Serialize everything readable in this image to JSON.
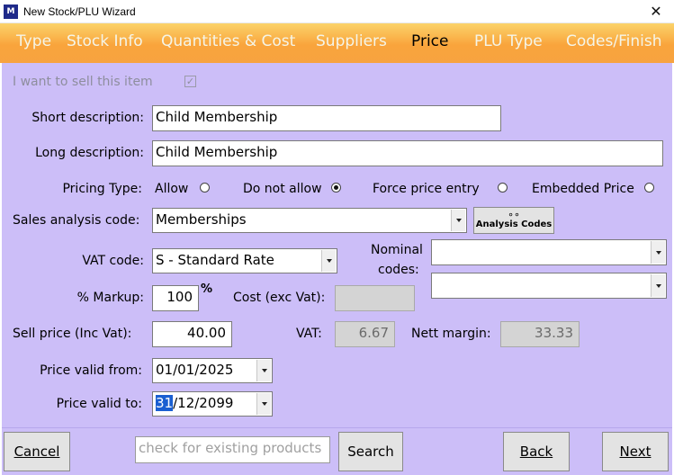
{
  "window": {
    "title": "New Stock/PLU Wizard",
    "icon_text": "M",
    "close_glyph": "✕"
  },
  "tabs": [
    "Type",
    "Stock Info",
    "Quantities & Cost",
    "Suppliers",
    "Price",
    "PLU Type",
    "Codes/Finish"
  ],
  "active_tab": "Price",
  "form": {
    "sell_item_label": "I want to sell this item",
    "sell_item_checked": true,
    "short_desc_label": "Short description:",
    "short_desc_value": "Child Membership",
    "long_desc_label": "Long description:",
    "long_desc_value": "Child Membership",
    "pricing_type_label": "Pricing Type:",
    "pricing_options": [
      "Allow",
      "Do not allow",
      "Force price entry",
      "Embedded Price"
    ],
    "pricing_selected": "Do not allow",
    "sales_code_label": "Sales analysis code:",
    "sales_code_value": "Memberships",
    "analysis_button": "Analysis Codes",
    "vat_code_label": "VAT code:",
    "vat_code_value": "S - Standard Rate",
    "nominal_label_1": "Nominal",
    "nominal_label_2": "codes:",
    "nominal_1": "",
    "nominal_2": "",
    "markup_label": "% Markup:",
    "markup_value": "100",
    "pct_symbol": "%",
    "cost_label": "Cost (exc Vat):",
    "cost_value": "",
    "sell_price_label": "Sell price (Inc Vat):",
    "sell_price_value": "40.00",
    "vat_label": "VAT:",
    "vat_value": "6.67",
    "nett_margin_label": "Nett margin:",
    "nett_margin_value": "33.33",
    "valid_from_label": "Price valid from:",
    "valid_from_value": "01/01/2025",
    "valid_to_label": "Price valid to:",
    "valid_to_day": "31",
    "valid_to_rest": "/12/2099"
  },
  "bottom": {
    "cancel": "Cancel",
    "search_placeholder": "check for existing products",
    "search": "Search",
    "back": "Back",
    "next": "Next"
  },
  "colors": {
    "panel": "#ccbef8",
    "tab_gradient_top": "#fbd36a",
    "tab_gradient_bottom": "#f7a340"
  }
}
